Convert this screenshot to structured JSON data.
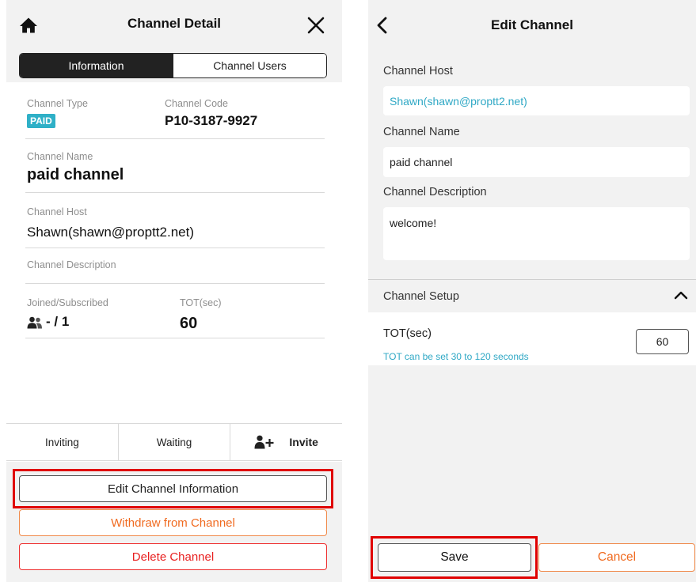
{
  "left": {
    "header": {
      "title": "Channel Detail"
    },
    "segments": {
      "information": "Information",
      "channel_users": "Channel Users"
    },
    "channel_type": {
      "label": "Channel Type",
      "value": "PAID"
    },
    "channel_code": {
      "label": "Channel Code",
      "value": "P10-3187-9927"
    },
    "channel_name": {
      "label": "Channel Name",
      "value": "paid channel"
    },
    "channel_host": {
      "label": "Channel Host",
      "value": "Shawn(shawn@proptt2.net)"
    },
    "channel_description": {
      "label": "Channel Description",
      "value": ""
    },
    "joined": {
      "label": "Joined/Subscribed",
      "value": "- / 1"
    },
    "tot": {
      "label": "TOT(sec)",
      "value": "60"
    },
    "tabs": {
      "inviting": "Inviting",
      "waiting": "Waiting",
      "invite": "Invite"
    },
    "buttons": {
      "edit": "Edit Channel Information",
      "withdraw": "Withdraw from Channel",
      "delete": "Delete Channel"
    }
  },
  "right": {
    "header": {
      "title": "Edit Channel"
    },
    "channel_host": {
      "label": "Channel Host",
      "value": "Shawn(shawn@proptt2.net)"
    },
    "channel_name": {
      "label": "Channel Name",
      "value": "paid channel"
    },
    "channel_description": {
      "label": "Channel Description",
      "value": "welcome!"
    },
    "setup": {
      "label": "Channel Setup",
      "tot_label": "TOT(sec)",
      "tot_hint": "TOT can be set 30 to 120 seconds",
      "tot_value": "60"
    },
    "buttons": {
      "save": "Save",
      "cancel": "Cancel"
    }
  },
  "colors": {
    "accent": "#2fb0c7",
    "highlight": "#e00000",
    "withdraw": "#f06a1f",
    "delete": "#e82020",
    "panel_gray": "#f2f2f2"
  },
  "icons": [
    "home-icon",
    "close-icon",
    "users-icon",
    "add-user-icon",
    "back-icon",
    "chevron-up-icon"
  ]
}
